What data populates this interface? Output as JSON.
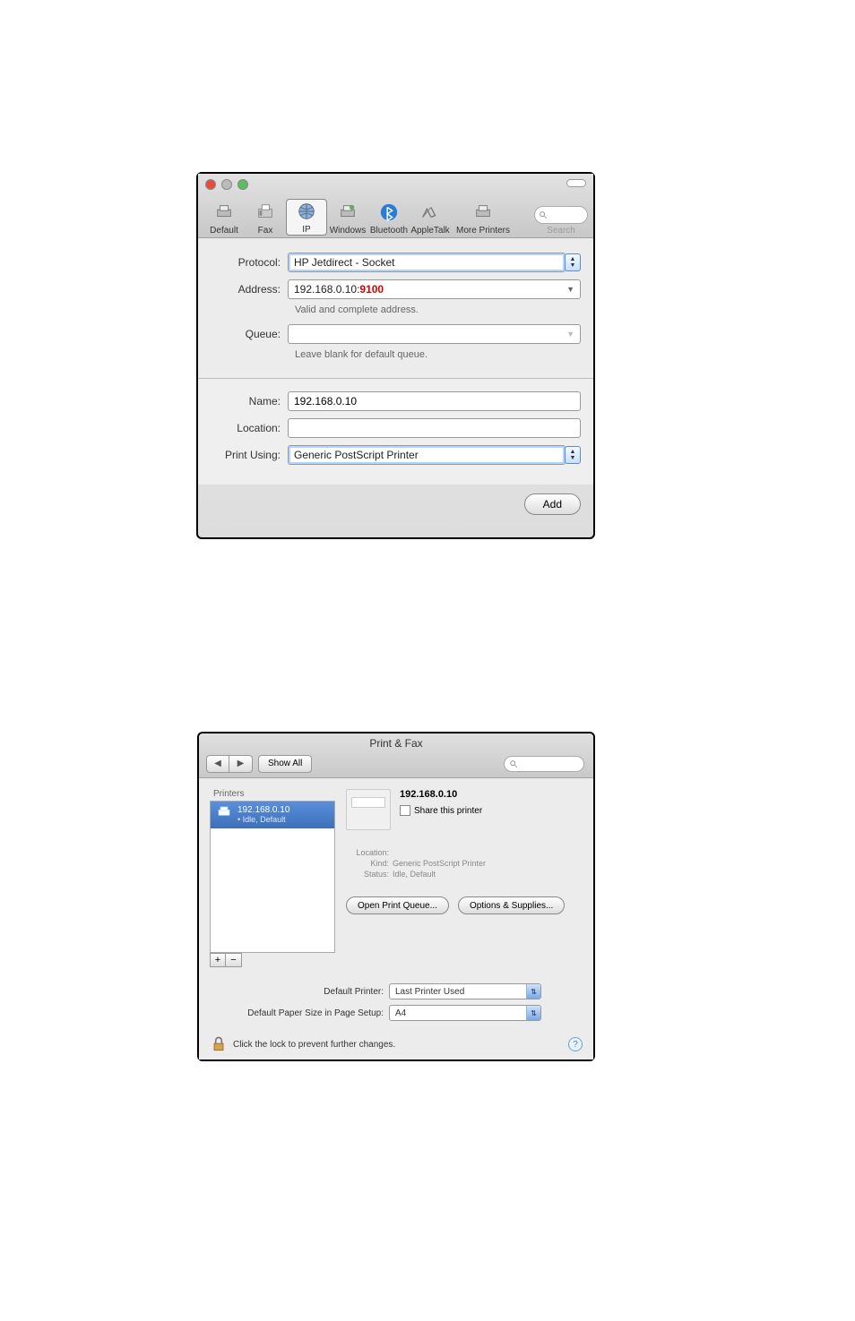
{
  "win1": {
    "toolbar": {
      "items": [
        {
          "label": "Default"
        },
        {
          "label": "Fax"
        },
        {
          "label": "IP"
        },
        {
          "label": "Windows"
        },
        {
          "label": "Bluetooth"
        },
        {
          "label": "AppleTalk"
        },
        {
          "label": "More Printers"
        }
      ],
      "search_label": "Search"
    },
    "form": {
      "protocol": {
        "label": "Protocol:",
        "value": "HP Jetdirect - Socket"
      },
      "address": {
        "label": "Address:",
        "value_pre": "192.168.0.10:",
        "value_hl": "9100",
        "helper": "Valid and complete address."
      },
      "queue": {
        "label": "Queue:",
        "value": "",
        "helper": "Leave blank for default queue."
      },
      "name": {
        "label": "Name:",
        "value": "192.168.0.10"
      },
      "location": {
        "label": "Location:",
        "value": ""
      },
      "printusing": {
        "label": "Print Using:",
        "value": "Generic PostScript Printer"
      }
    },
    "add_button": "Add"
  },
  "win2": {
    "title": "Print & Fax",
    "showall": "Show All",
    "sidebar": {
      "heading": "Printers",
      "item_name": "192.168.0.10",
      "item_status": "• Idle, Default"
    },
    "detail": {
      "name": "192.168.0.10",
      "share": "Share this printer",
      "location": {
        "k": "Location:",
        "v": ""
      },
      "kind": {
        "k": "Kind:",
        "v": "Generic PostScript Printer"
      },
      "status": {
        "k": "Status:",
        "v": "Idle, Default"
      },
      "open_queue": "Open Print Queue...",
      "options": "Options & Supplies..."
    },
    "defaults": {
      "printer": {
        "k": "Default Printer:",
        "v": "Last Printer Used"
      },
      "paper": {
        "k": "Default Paper Size in Page Setup:",
        "v": "A4"
      }
    },
    "lock_text": "Click the lock to prevent further changes."
  }
}
